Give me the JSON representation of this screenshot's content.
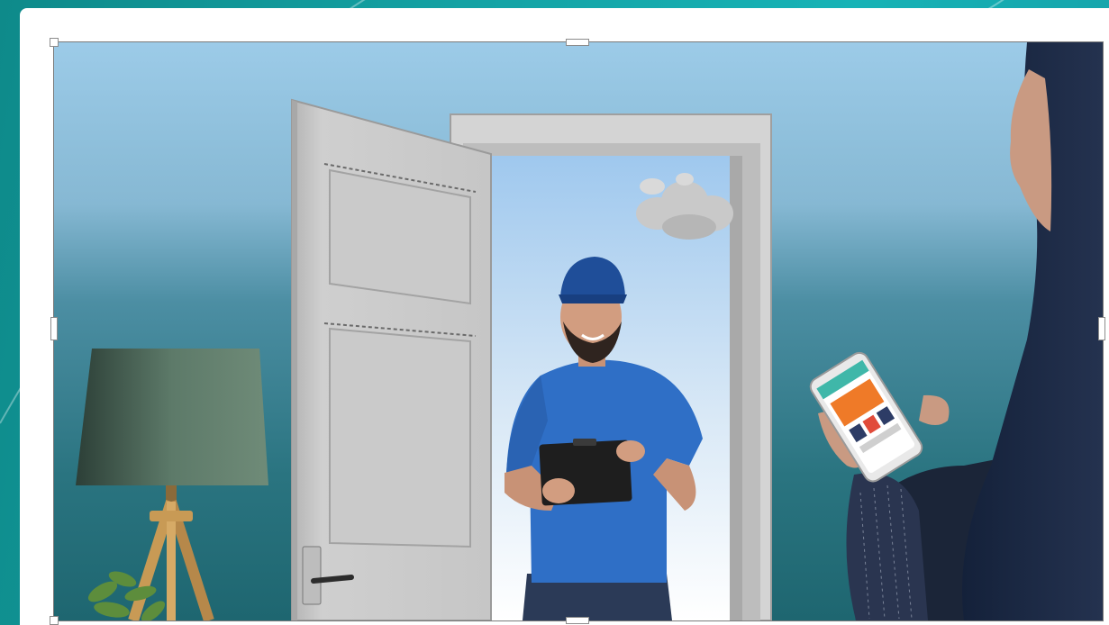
{
  "window": {
    "background_color": "#14a3a5",
    "canvas_color": "#ffffff"
  },
  "selected_image": {
    "state": "selected",
    "content": "photo-illustration",
    "handles": [
      "top-left",
      "top-center",
      "top-right",
      "middle-left",
      "middle-right",
      "bottom-left",
      "bottom-center",
      "bottom-right"
    ],
    "colors": {
      "sky_top": "#9ccbe8",
      "wall_bottom": "#1e6670",
      "door": "#c9c9c9",
      "shirt": "#2f6fc6",
      "cap": "#1f4e99",
      "hijab": "#1b2942",
      "lampshade": "#4f6a5c"
    },
    "icons": [
      "floor-lamp",
      "potted-plant",
      "door",
      "delivery-man",
      "clipboard",
      "woman-in-hijab",
      "smartphone",
      "cloud"
    ]
  }
}
